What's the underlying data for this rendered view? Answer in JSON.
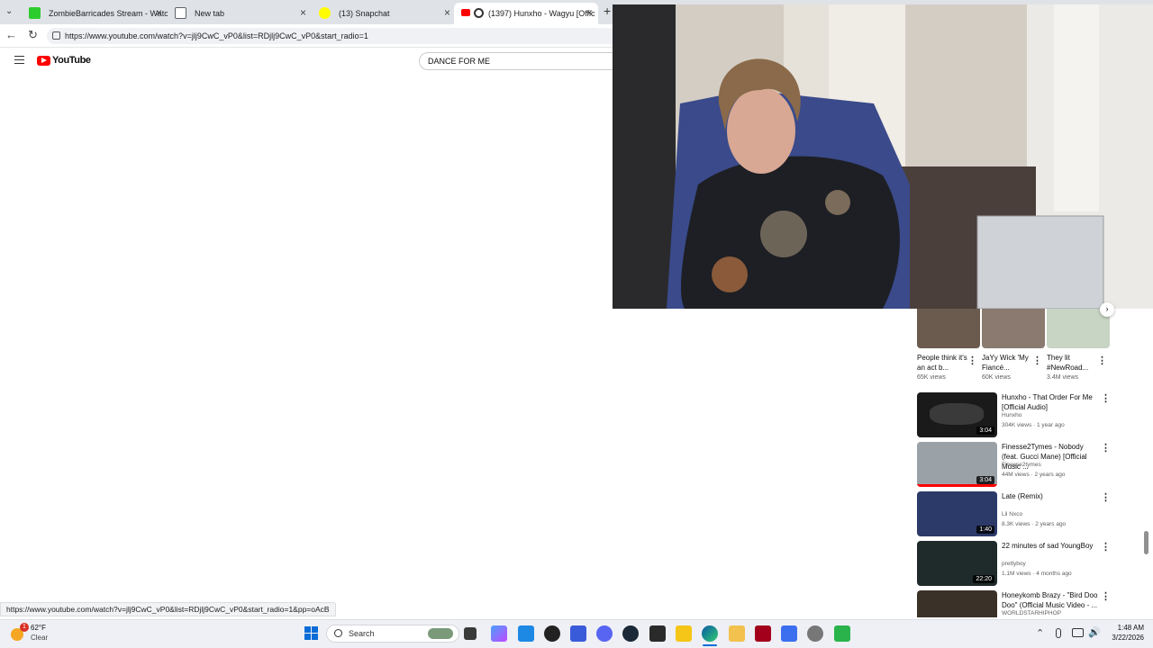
{
  "tabs": [
    {
      "title": "ZombieBarricades Stream - Watch",
      "favicon_color": "#2dcc2d"
    },
    {
      "title": "New tab",
      "favicon_color": "#5f6368"
    },
    {
      "title": "(13) Snapchat",
      "favicon_color": "#fffc00"
    },
    {
      "title": "(1397) Hunxho - Wagyu [Offic",
      "favicon_color": "#ff0000"
    }
  ],
  "address": {
    "url": "https://www.youtube.com/watch?v=jlj9CwC_vP0&list=RDjlj9CwC_vP0&start_radio=1"
  },
  "youtube": {
    "logo_text": "YouTube",
    "search_value": "DANCE FOR ME"
  },
  "shorts": [
    {
      "title": "People think it's an act b...",
      "views": "65K views"
    },
    {
      "title": "JaYy Wick 'My Fiancé...",
      "views": "60K views"
    },
    {
      "title": "They lit #NewRoad...",
      "views": "3.4M views"
    }
  ],
  "recommendations": [
    {
      "title": "Hunxho - That Order For Me [Official Audio]",
      "channel": "Hunxho",
      "meta": "304K views · 1 year ago",
      "duration": "3:04"
    },
    {
      "title": "Finesse2Tymes - Nobody (feat. Gucci Mane) [Official Music ...",
      "channel": "Finesse2tymes",
      "meta": "44M views · 2 years ago",
      "duration": "3:04"
    },
    {
      "title": "Late (Remix)",
      "channel": "Lil Nxco",
      "meta": "8.3K views · 2 years ago",
      "duration": "1:40"
    },
    {
      "title": "22 minutes of sad YoungBoy",
      "channel": "prettyboy",
      "meta": "1.1M views · 4 months ago",
      "duration": "22:20"
    },
    {
      "title": "Honeykomb Brazy - \"Bird Doo Doo\" (Official Music Video - ...",
      "channel": "WORLDSTARHIPHOP",
      "meta": "",
      "duration": ""
    }
  ],
  "status_url": "https://www.youtube.com/watch?v=jlj9CwC_vP0&list=RDjlj9CwC_vP0&start_radio=1&pp=oAcB",
  "taskbar": {
    "weather_temp": "62°F",
    "weather_desc": "Clear",
    "weather_badge": "1",
    "search_label": "Search",
    "time": "1:48 AM",
    "date": "3/22/2026"
  }
}
